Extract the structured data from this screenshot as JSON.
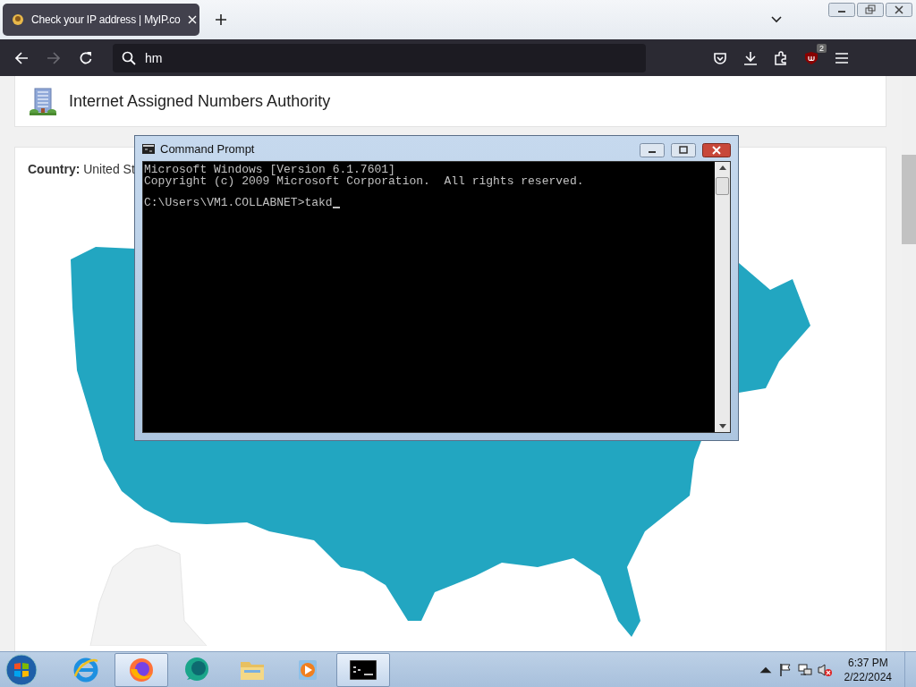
{
  "browser": {
    "tab": {
      "title": "Check your IP address | MyIP.co",
      "selected": true
    },
    "nav": [
      {
        "kind": "back",
        "disabled": false
      },
      {
        "kind": "forward",
        "disabled": true
      },
      {
        "kind": "reload",
        "disabled": false
      }
    ],
    "url_field": {
      "value": "hm"
    },
    "extension_badge": "2"
  },
  "page": {
    "organization": "Internet Assigned Numbers Authority",
    "country_label": "Country:",
    "country_value": "United St"
  },
  "cmd": {
    "title": "Command Prompt",
    "lines": [
      "Microsoft Windows [Version 6.1.7601]",
      "Copyright (c) 2009 Microsoft Corporation.  All rights reserved."
    ],
    "prompt": "C:\\Users\\VM1.COLLABNET>takd"
  },
  "taskbar": {
    "apps": [
      {
        "kind": "ie",
        "active": false
      },
      {
        "kind": "firefox",
        "active": true
      },
      {
        "kind": "teal",
        "active": false
      },
      {
        "kind": "folder",
        "active": false
      },
      {
        "kind": "media",
        "active": false
      },
      {
        "kind": "cmd",
        "active": true
      }
    ],
    "time": "6:37 PM",
    "date": "2/22/2024"
  }
}
